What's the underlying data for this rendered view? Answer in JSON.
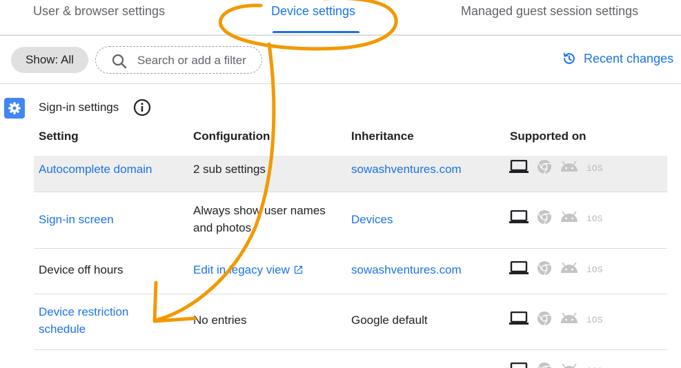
{
  "tabs": [
    {
      "label": "User & browser settings"
    },
    {
      "label": "Device settings",
      "active": true
    },
    {
      "label": "Managed guest session settings"
    }
  ],
  "filter": {
    "show_label": "Show: All",
    "search_placeholder": "Search or add a filter"
  },
  "recent_changes_label": "Recent changes",
  "section": {
    "title": "Sign-in settings",
    "icon": "gear-icon"
  },
  "table": {
    "headers": [
      "Setting",
      "Configuration",
      "Inheritance",
      "Supported on"
    ],
    "rows": [
      {
        "setting": "Autocomplete domain",
        "configuration": "2 sub settings",
        "inheritance": "sowashventures.com"
      },
      {
        "setting": "Sign-in screen",
        "configuration_lines": [
          "Always show user names",
          "and photos"
        ],
        "inheritance": "Devices"
      },
      {
        "setting": "Device off hours",
        "configuration": "Edit in legacy view",
        "inheritance": "sowashventures.com"
      },
      {
        "setting_lines": [
          "Device restriction",
          "schedule"
        ],
        "configuration": "No entries",
        "inheritance": "Google default"
      }
    ],
    "platform_icons": [
      "laptop-icon",
      "chrome-icon",
      "android-icon",
      "ios-icon"
    ],
    "ios_label": "iOS"
  },
  "colors": {
    "accent": "#1a73e8",
    "annotation": "#f29900",
    "row_highlight": "#eeeeee"
  }
}
